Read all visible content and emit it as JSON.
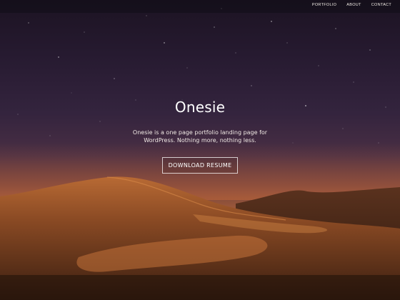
{
  "nav": {
    "items": [
      {
        "label": "PORTFOLIO"
      },
      {
        "label": "ABOUT"
      },
      {
        "label": "CONTACT"
      }
    ]
  },
  "hero": {
    "title": "Onesie",
    "tagline": "Onesie is a one page portfolio landing page for WordPress. Nothing more, nothing less.",
    "cta_label": "DOWNLOAD RESUME"
  }
}
